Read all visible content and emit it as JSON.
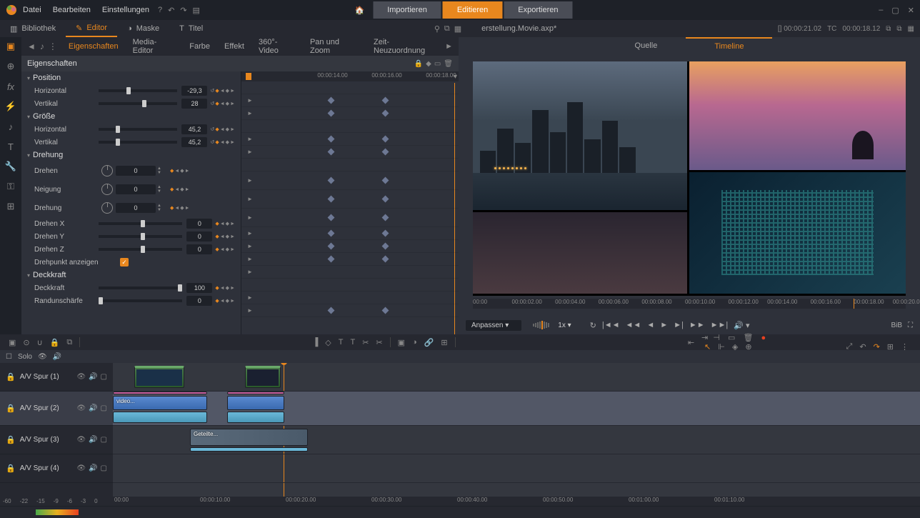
{
  "menu": {
    "file": "Datei",
    "edit": "Bearbeiten",
    "settings": "Einstellungen"
  },
  "modes": {
    "import": "Importieren",
    "edit": "Editieren",
    "export": "Exportieren"
  },
  "subtabs": {
    "library": "Bibliothek",
    "editor": "Editor",
    "mask": "Maske",
    "title": "Titel"
  },
  "document_title": "erstellung.Movie.axp*",
  "timecodes": {
    "marker": "[] 00:00:21.02",
    "tc_label": "TC",
    "tc_value": "00:00:18.12"
  },
  "editor_tabs": {
    "properties": "Eigenschaften",
    "media_editor": "Media-Editor",
    "color": "Farbe",
    "effect": "Effekt",
    "video360": "360°-Video",
    "panzoom": "Pan und Zoom",
    "time_reorder": "Zeit-Neuzuordnung"
  },
  "properties_header": "Eigenschaften",
  "sections": {
    "position": "Position",
    "size": "Größe",
    "rotation": "Drehung",
    "opacity": "Deckkraft"
  },
  "props": {
    "horizontal": "Horizontal",
    "vertical": "Vertikal",
    "rotate": "Drehen",
    "tilt": "Neigung",
    "rotation": "Drehung",
    "rotate_x": "Drehen X",
    "rotate_y": "Drehen Y",
    "rotate_z": "Drehen Z",
    "show_pivot": "Drehpunkt anzeigen",
    "opacity": "Deckkraft",
    "edge_blur": "Randunschärfe"
  },
  "values": {
    "pos_h": "-29,3",
    "pos_v": "28",
    "size_h": "45,2",
    "size_v": "45,2",
    "rotate": "0",
    "tilt": "0",
    "rotation": "0",
    "rot_x": "0",
    "rot_y": "0",
    "rot_z": "0",
    "opacity": "100",
    "edge_blur": "0"
  },
  "kf_ruler": {
    "t1": "00:00:14.00",
    "t2": "00:00:16.00",
    "t3": "00:00:18.00"
  },
  "preview_tabs": {
    "source": "Quelle",
    "timeline": "Timeline"
  },
  "preview_ruler": [
    "00:00",
    "00:00:02.00",
    "00:00:04.00",
    "00:00:06.00",
    "00:00:08.00",
    "00:00:10.00",
    "00:00:12.00",
    "00:00:14.00",
    "00:00:16.00",
    "00:00:18.00",
    "00:00:20.00"
  ],
  "preview_controls": {
    "fit": "Anpassen",
    "speed": "1x",
    "bib": "BiB"
  },
  "solo": {
    "label": "Solo"
  },
  "tracks": [
    {
      "name": "A/V Spur (1)"
    },
    {
      "name": "A/V Spur (2)"
    },
    {
      "name": "A/V Spur (3)"
    },
    {
      "name": "A/V Spur (4)"
    }
  ],
  "clip_labels": {
    "video": "video...",
    "split": "Geteilte..."
  },
  "bottom_ruler": [
    "00:00",
    "00:00:10.00",
    "00:00:20.00",
    "00:00:30.00",
    "00:00:40.00",
    "00:00:50.00",
    "00:01:00.00",
    "00:01:10.00"
  ],
  "meter_scale": [
    "-60",
    "-22",
    "-15",
    "-9",
    "-6",
    "-3",
    "0"
  ]
}
